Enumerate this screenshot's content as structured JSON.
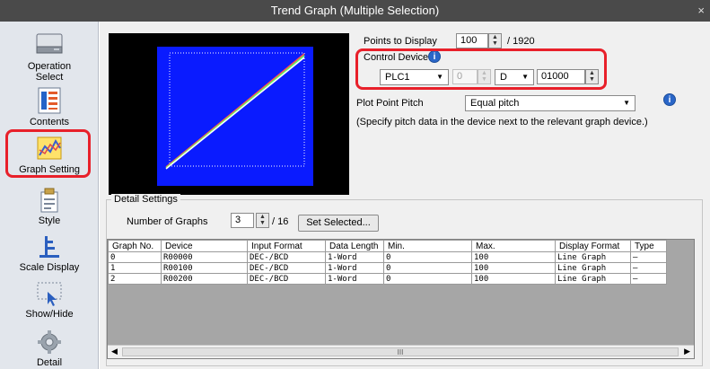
{
  "window": {
    "title": "Trend Graph (Multiple Selection)",
    "close": "×"
  },
  "sidebar": {
    "items": [
      {
        "label": "Operation\nSelect",
        "line1": "Operation",
        "line2": "Select"
      },
      {
        "label": "Contents"
      },
      {
        "label": "Graph Setting",
        "selected": true
      },
      {
        "label": "Style"
      },
      {
        "label": "Scale Display"
      },
      {
        "label": "Show/Hide"
      },
      {
        "label": "Detail"
      }
    ]
  },
  "settings": {
    "points_label": "Points to Display",
    "points_value": "100",
    "points_total": "/ 1920",
    "control_device_label": "Control Device",
    "plc_value": "PLC1",
    "station_value": "0",
    "device_type_value": "D",
    "address_value": "01000",
    "pitch_label": "Plot Point Pitch",
    "pitch_value": "Equal pitch",
    "pitch_note": "(Specify pitch data in the device next to the relevant graph device.)"
  },
  "detail": {
    "legend": "Detail Settings",
    "graphs_label": "Number of Graphs",
    "graphs_value": "3",
    "graphs_total": "/ 16",
    "set_selected_label": "Set Selected...",
    "columns": [
      "Graph No.",
      "Device",
      "Input Format",
      "Data Length",
      "Min.",
      "Max.",
      "Display Format",
      "Type"
    ],
    "rows": [
      [
        "0",
        "R00000",
        "DEC-/BCD",
        "1-Word",
        "0",
        "100",
        "Line Graph",
        "—"
      ],
      [
        "1",
        "R00100",
        "DEC-/BCD",
        "1-Word",
        "0",
        "100",
        "Line Graph",
        "—"
      ],
      [
        "2",
        "R00200",
        "DEC-/BCD",
        "1-Word",
        "0",
        "100",
        "Line Graph",
        "—"
      ]
    ],
    "scroll_thumb": "III"
  },
  "colors": {
    "titlebar": "#4a4a4a",
    "highlight": "#e8202a",
    "plot_bg": "#0a1bff",
    "sidebar_bg": "#e2e6ec"
  }
}
